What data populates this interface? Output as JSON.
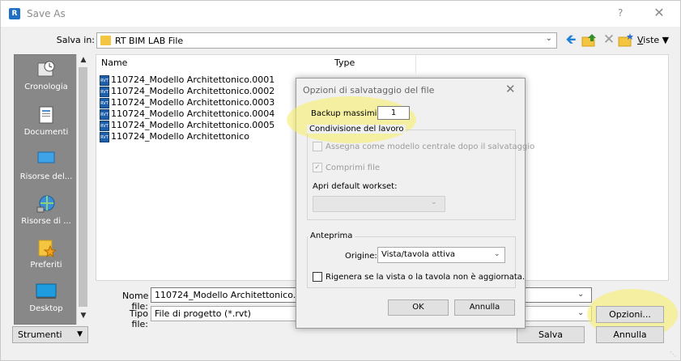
{
  "window": {
    "title": "Save As",
    "help_glyph": "?",
    "close_glyph": "✕"
  },
  "save_in": {
    "label": "Salva in:",
    "value": "RT BIM LAB File"
  },
  "toolbar": {
    "views_label_u": "V",
    "views_label_rest": "iste"
  },
  "places": [
    {
      "label": "Cronologia",
      "icon": "history-icon"
    },
    {
      "label": "Documenti",
      "icon": "documents-icon"
    },
    {
      "label": "Risorse del...",
      "icon": "computer-icon"
    },
    {
      "label": "Risorse di ...",
      "icon": "network-icon"
    },
    {
      "label": "Preferiti",
      "icon": "favorites-icon"
    },
    {
      "label": "Desktop",
      "icon": "desktop-icon"
    }
  ],
  "file_list": {
    "col_name": "Name",
    "col_type": "Type",
    "files": [
      "110724_Modello Architettonico.0001",
      "110724_Modello Architettonico.0002",
      "110724_Modello Architettonico.0003",
      "110724_Modello Architettonico.0004",
      "110724_Modello Architettonico.0005",
      "110724_Modello Architettonico"
    ]
  },
  "file_name": {
    "label": "Nome file:",
    "value": "110724_Modello Architettonico.rvt"
  },
  "file_type": {
    "label": "Tipo file:",
    "value": "File di progetto  (*.rvt)"
  },
  "buttons": {
    "options": "Opzioni...",
    "save": "Salva",
    "cancel": "Annulla",
    "tools": "Strumenti"
  },
  "options_dialog": {
    "title": "Opzioni di salvataggio del file",
    "close_glyph": "✕",
    "backup_label": "Backup massimi:",
    "backup_value": "1",
    "worksharing_group": "Condivisione del lavoro",
    "make_central_label": "Assegna come modello centrale dopo il salvataggio",
    "compress_label": "Comprimi file",
    "open_workset_label": "Apri default workset:",
    "preview_group": "Anteprima",
    "source_label": "Origine:",
    "source_value": "Vista/tavola attiva",
    "regenerate_label": "Rigenera se la vista o la tavola non è aggiornata.",
    "ok": "OK",
    "cancel": "Annulla"
  }
}
